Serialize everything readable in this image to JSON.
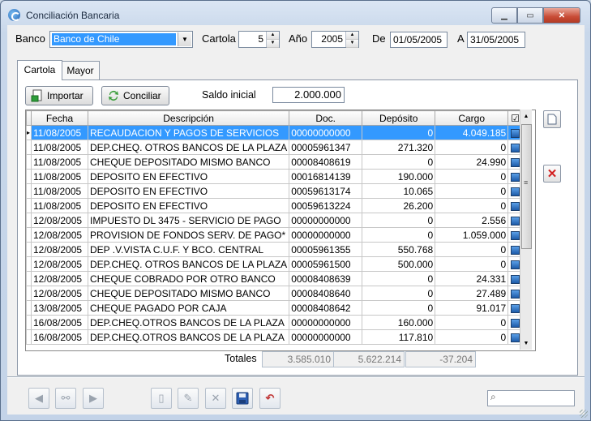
{
  "window": {
    "title": "Conciliación Bancaria"
  },
  "header": {
    "banco_label": "Banco",
    "banco_value": "Banco de Chile",
    "cartola_label": "Cartola",
    "cartola_value": "5",
    "ano_label": "Año",
    "ano_value": "2005",
    "de_label": "De",
    "de_value": "01/05/2005",
    "a_label": "A",
    "a_value": "31/05/2005"
  },
  "tabs": [
    {
      "label": "Cartola",
      "active": true
    },
    {
      "label": "Mayor",
      "active": false
    }
  ],
  "toolbar": {
    "importar_label": "Importar",
    "conciliar_label": "Conciliar",
    "saldo_label": "Saldo inicial",
    "saldo_value": "2.000.000"
  },
  "grid": {
    "columns": [
      "Fecha",
      "Descripción",
      "Doc.",
      "Depósito",
      "Cargo",
      "☑"
    ],
    "rows": [
      [
        "11/08/2005",
        "RECAUDACION Y PAGOS DE SERVICIOS",
        "00000000000",
        "0",
        "4.049.185"
      ],
      [
        "11/08/2005",
        "DEP.CHEQ. OTROS BANCOS DE LA PLAZA",
        "00005961347",
        "271.320",
        "0"
      ],
      [
        "11/08/2005",
        "CHEQUE DEPOSITADO MISMO BANCO",
        "00008408619",
        "0",
        "24.990"
      ],
      [
        "11/08/2005",
        "DEPOSITO EN EFECTIVO",
        "00016814139",
        "190.000",
        "0"
      ],
      [
        "11/08/2005",
        "DEPOSITO EN EFECTIVO",
        "00059613174",
        "10.065",
        "0"
      ],
      [
        "11/08/2005",
        "DEPOSITO EN EFECTIVO",
        "00059613224",
        "26.200",
        "0"
      ],
      [
        "12/08/2005",
        "IMPUESTO DL 3475 - SERVICIO DE PAGO",
        "00000000000",
        "0",
        "2.556"
      ],
      [
        "12/08/2005",
        "PROVISION DE FONDOS SERV. DE PAGO*",
        "00000000000",
        "0",
        "1.059.000"
      ],
      [
        "12/08/2005",
        "DEP .V.VISTA C.U.F. Y BCO. CENTRAL",
        "00005961355",
        "550.768",
        "0"
      ],
      [
        "12/08/2005",
        "DEP.CHEQ. OTROS BANCOS DE LA PLAZA",
        "00005961500",
        "500.000",
        "0"
      ],
      [
        "12/08/2005",
        "CHEQUE COBRADO POR OTRO BANCO",
        "00008408639",
        "0",
        "24.331"
      ],
      [
        "12/08/2005",
        "CHEQUE DEPOSITADO MISMO BANCO",
        "00008408640",
        "0",
        "27.489"
      ],
      [
        "13/08/2005",
        "CHEQUE PAGADO POR CAJA",
        "00008408642",
        "0",
        "91.017"
      ],
      [
        "16/08/2005",
        "DEP.CHEQ.OTROS BANCOS DE LA PLAZA",
        "00000000000",
        "160.000",
        "0"
      ],
      [
        "16/08/2005",
        "DEP.CHEQ.OTROS BANCOS DE LA PLAZA",
        "00000000000",
        "117.810",
        "0"
      ]
    ]
  },
  "totals": {
    "label": "Totales",
    "deposito": "3.585.010",
    "cargo": "5.622.214",
    "diferencia": "-37.204"
  }
}
